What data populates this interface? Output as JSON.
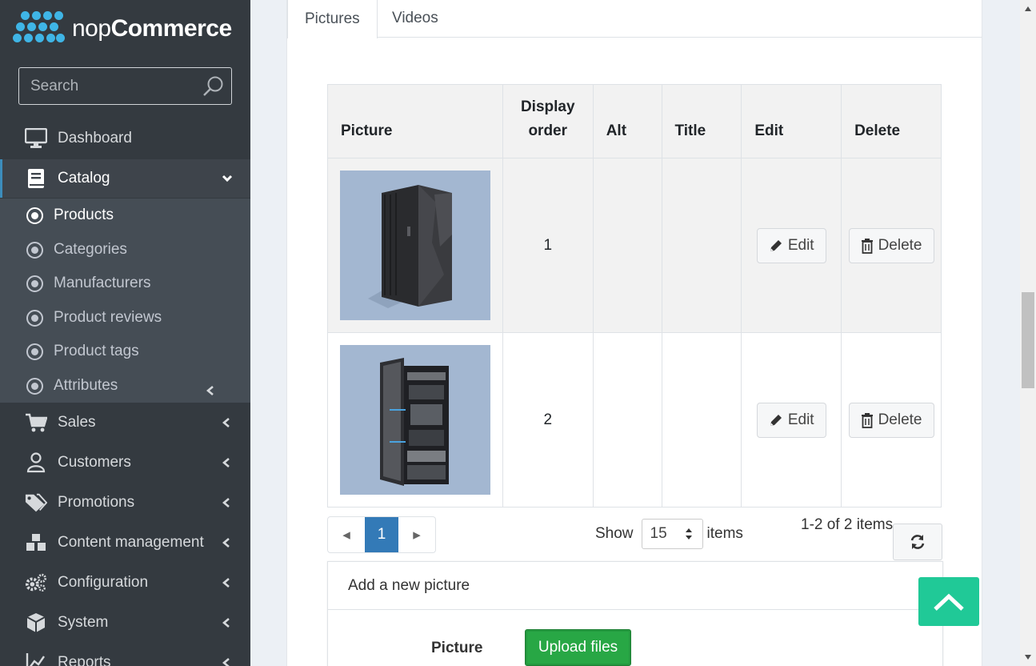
{
  "logo": {
    "prefix": "nop",
    "brand": "Commerce"
  },
  "search": {
    "placeholder": "Search"
  },
  "sidebar": {
    "items": [
      {
        "label": "Dashboard",
        "icon": "monitor-icon"
      },
      {
        "label": "Catalog",
        "icon": "book-icon",
        "expanded": true
      },
      {
        "label": "Sales",
        "icon": "cart-icon"
      },
      {
        "label": "Customers",
        "icon": "user-icon"
      },
      {
        "label": "Promotions",
        "icon": "tags-icon"
      },
      {
        "label": "Content management",
        "icon": "cubes-icon"
      },
      {
        "label": "Configuration",
        "icon": "gears-icon"
      },
      {
        "label": "System",
        "icon": "cube-icon"
      },
      {
        "label": "Reports",
        "icon": "chart-icon"
      }
    ],
    "catalog_sub": [
      {
        "label": "Products",
        "current": true
      },
      {
        "label": "Categories"
      },
      {
        "label": "Manufacturers"
      },
      {
        "label": "Product reviews"
      },
      {
        "label": "Product tags"
      },
      {
        "label": "Attributes"
      }
    ]
  },
  "tabs": [
    {
      "label": "Pictures",
      "active": true
    },
    {
      "label": "Videos"
    }
  ],
  "table": {
    "columns": [
      "Picture",
      "Display order",
      "Alt",
      "Title",
      "Edit",
      "Delete"
    ],
    "col_display_order_line1": "Display",
    "col_display_order_line2": "order",
    "rows": [
      {
        "display_order": "1",
        "alt": "",
        "title": "",
        "edit": "Edit",
        "delete": "Delete"
      },
      {
        "display_order": "2",
        "alt": "",
        "title": "",
        "edit": "Edit",
        "delete": "Delete"
      }
    ]
  },
  "pager": {
    "prev": "◂",
    "page": "1",
    "next": "▸",
    "show_label": "Show",
    "page_size": "15",
    "items_label": "items",
    "info": "1-2 of 2 items"
  },
  "add_picture": {
    "header": "Add a new picture",
    "field_label": "Picture",
    "upload_label": "Upload files"
  },
  "colors": {
    "sidebar_bg": "#343a40",
    "submenu_bg": "#454d55",
    "accent": "#3c8dbc",
    "pager_active": "#337ab7",
    "upload_green": "#28a745",
    "back_to_top": "#20c997",
    "thumb_bg": "#a3b7d1"
  }
}
